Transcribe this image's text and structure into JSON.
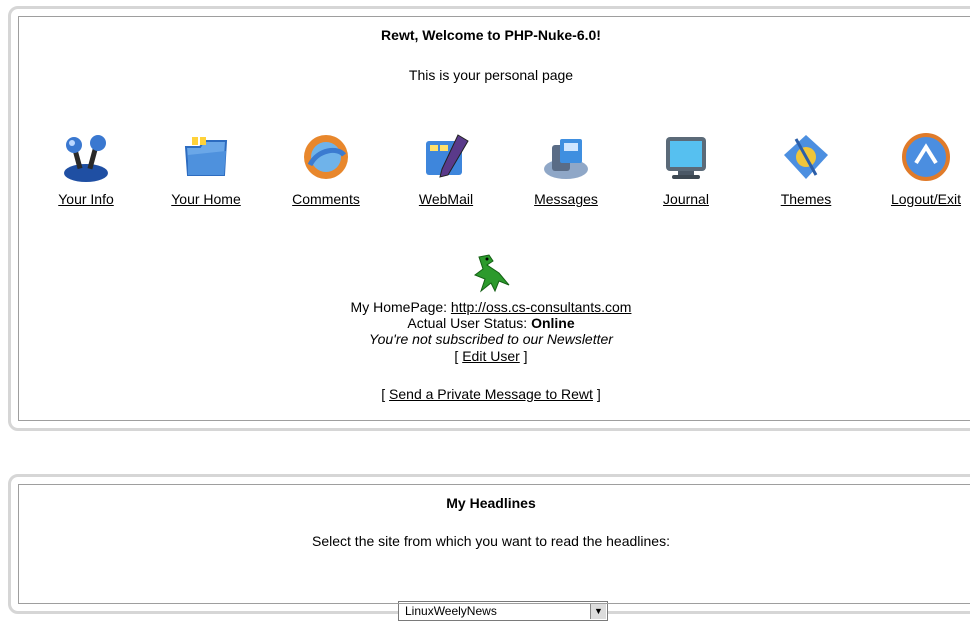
{
  "personal": {
    "welcome": "Rewt, Welcome to PHP-Nuke-6.0!",
    "subtitle": "This is your personal page",
    "menu": [
      {
        "label": "Your Info",
        "icon": "joystick-icon"
      },
      {
        "label": "Your Home",
        "icon": "home-folder-icon"
      },
      {
        "label": "Comments",
        "icon": "comments-icon"
      },
      {
        "label": "WebMail",
        "icon": "webmail-icon"
      },
      {
        "label": "Messages",
        "icon": "messages-icon"
      },
      {
        "label": "Journal",
        "icon": "journal-monitor-icon"
      },
      {
        "label": "Themes",
        "icon": "themes-icon"
      },
      {
        "label": "Logout/Exit",
        "icon": "logout-icon"
      }
    ],
    "avatar_icon": "green-dragon-icon",
    "homepage_label": "My HomePage: ",
    "homepage_url": "http://oss.cs-consultants.com",
    "status_label": "Actual User Status: ",
    "status_value": "Online",
    "newsletter": "You're not subscribed to our Newsletter",
    "edit_user_pre": "[ ",
    "edit_user": "Edit User",
    "edit_user_post": " ]",
    "private_msg_pre": "[ ",
    "private_msg": "Send a Private Message to Rewt",
    "private_msg_post": " ]"
  },
  "headlines": {
    "title": "My Headlines",
    "prompt": "Select the site from which you want to read the headlines:",
    "selected_site": "LinuxWeelyNews"
  }
}
